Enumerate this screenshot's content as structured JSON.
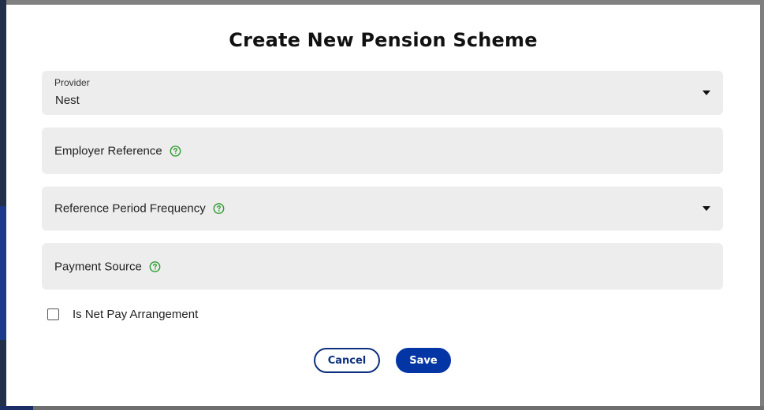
{
  "dialog": {
    "title": "Create New Pension Scheme"
  },
  "fields": {
    "provider": {
      "label": "Provider",
      "value": "Nest"
    },
    "employer_reference": {
      "label": "Employer Reference"
    },
    "reference_period_frequency": {
      "label": "Reference Period Frequency"
    },
    "payment_source": {
      "label": "Payment Source"
    }
  },
  "checkbox": {
    "label": "Is Net Pay Arrangement",
    "checked": false
  },
  "buttons": {
    "cancel_label": "Cancel",
    "save_label": "Save"
  },
  "colors": {
    "accent": "#0336a4",
    "help_icon": "#2e9b2e",
    "field_bg": "#ededed"
  },
  "icons": {
    "help": "question-circle-icon",
    "dropdown": "caret-down-icon"
  }
}
